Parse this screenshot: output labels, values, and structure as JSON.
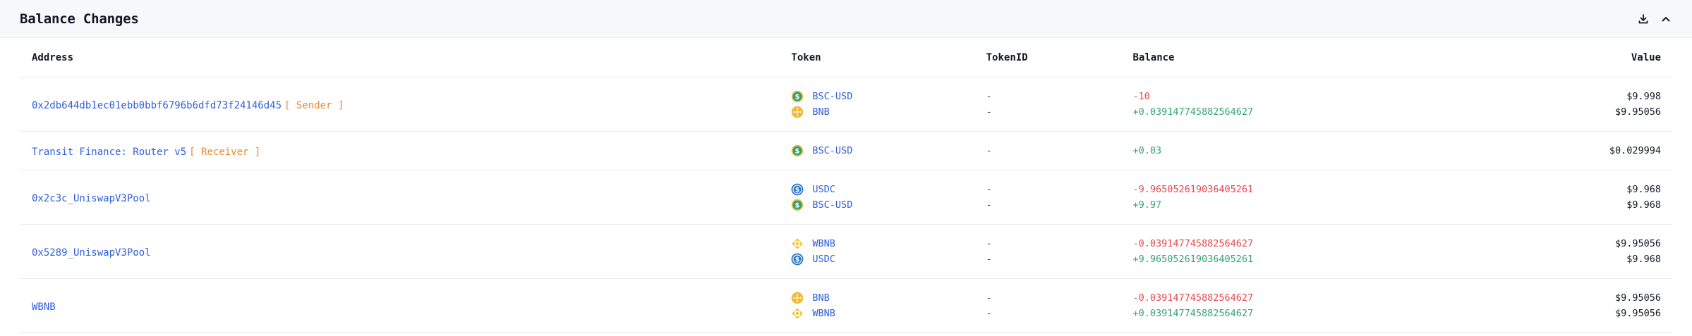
{
  "panel": {
    "title": "Balance Changes"
  },
  "icons": {
    "download": "download-icon",
    "collapse": "chevron-up-icon"
  },
  "columns": {
    "address": "Address",
    "token": "Token",
    "tokenid": "TokenID",
    "balance": "Balance",
    "value": "Value"
  },
  "colors": {
    "link": "#2f5fd6",
    "tag": "#f0872a",
    "negative": "#e5484d",
    "positive": "#35a373"
  },
  "rows": [
    {
      "address": "0x2db644db1ec01ebb0bbf6796b6dfd73f24146d45",
      "tag": "[ Sender ]",
      "items": [
        {
          "token": "BSC-USD",
          "icon": "bsc-usd-icon",
          "tokenid": "-",
          "balance": "-10",
          "value": "$9.998"
        },
        {
          "token": "BNB",
          "icon": "bnb-icon",
          "tokenid": "-",
          "balance": "+0.039147745882564627",
          "value": "$9.95056"
        }
      ]
    },
    {
      "address": "Transit Finance: Router v5",
      "tag": "[ Receiver ]",
      "items": [
        {
          "token": "BSC-USD",
          "icon": "bsc-usd-icon",
          "tokenid": "-",
          "balance": "+0.03",
          "value": "$0.029994"
        }
      ]
    },
    {
      "address": "0x2c3c_UniswapV3Pool",
      "tag": "",
      "items": [
        {
          "token": "USDC",
          "icon": "usdc-icon",
          "tokenid": "-",
          "balance": "-9.965052619036405261",
          "value": "$9.968"
        },
        {
          "token": "BSC-USD",
          "icon": "bsc-usd-icon",
          "tokenid": "-",
          "balance": "+9.97",
          "value": "$9.968"
        }
      ]
    },
    {
      "address": "0x5289_UniswapV3Pool",
      "tag": "",
      "items": [
        {
          "token": "WBNB",
          "icon": "wbnb-icon",
          "tokenid": "-",
          "balance": "-0.039147745882564627",
          "value": "$9.95056"
        },
        {
          "token": "USDC",
          "icon": "usdc-icon",
          "tokenid": "-",
          "balance": "+9.965052619036405261",
          "value": "$9.968"
        }
      ]
    },
    {
      "address": "WBNB",
      "tag": "",
      "items": [
        {
          "token": "BNB",
          "icon": "bnb-icon",
          "tokenid": "-",
          "balance": "-0.039147745882564627",
          "value": "$9.95056"
        },
        {
          "token": "WBNB",
          "icon": "wbnb-icon",
          "tokenid": "-",
          "balance": "+0.039147745882564627",
          "value": "$9.95056"
        }
      ]
    }
  ]
}
